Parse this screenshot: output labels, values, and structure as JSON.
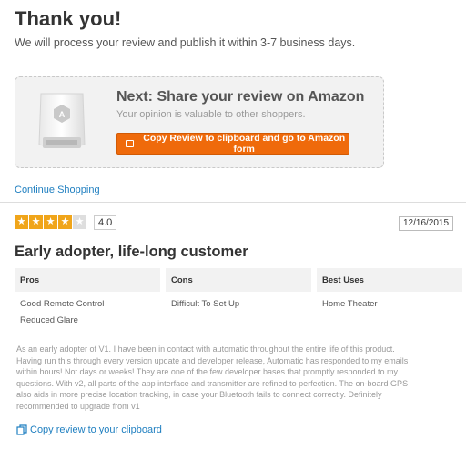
{
  "header": {
    "title": "Thank you!",
    "subtitle": "We will process your review and publish it within 3-7 business days."
  },
  "promo": {
    "heading": "Next: Share your review on Amazon",
    "subtext": "Your opinion is valuable to other shoppers.",
    "button_label": "Copy Review to clipboard and go to Amazon form",
    "device_icon": "obd-device-image",
    "button_color": "#ef6a0b"
  },
  "nav": {
    "continue_label": "Continue Shopping"
  },
  "review": {
    "rating": 4,
    "rating_max": 5,
    "rating_text": "4.0",
    "date": "12/16/2015",
    "title": "Early adopter, life-long customer",
    "columns": [
      {
        "header": "Pros",
        "items": [
          "Good Remote Control",
          "Reduced Glare"
        ]
      },
      {
        "header": "Cons",
        "items": [
          "Difficult To Set Up"
        ]
      },
      {
        "header": "Best Uses",
        "items": [
          "Home Theater"
        ]
      }
    ],
    "body": "As an early adopter of V1. I have been in contact with automatic throughout the entire life of this product. Having run this through every version update and developer release, Automatic has responded to my emails within hours! Not days or weeks! They are one of the few developer bases that promptly responded to my questions. With v2, all parts of the app interface and transmitter are refined to perfection. The on-board GPS also aids in more precise location tracking, in case your Bluetooth fails to connect correctly. Definitely recommended to upgrade from v1",
    "copy_label": "Copy review to your clipboard",
    "star_color": "#f0a51a"
  }
}
